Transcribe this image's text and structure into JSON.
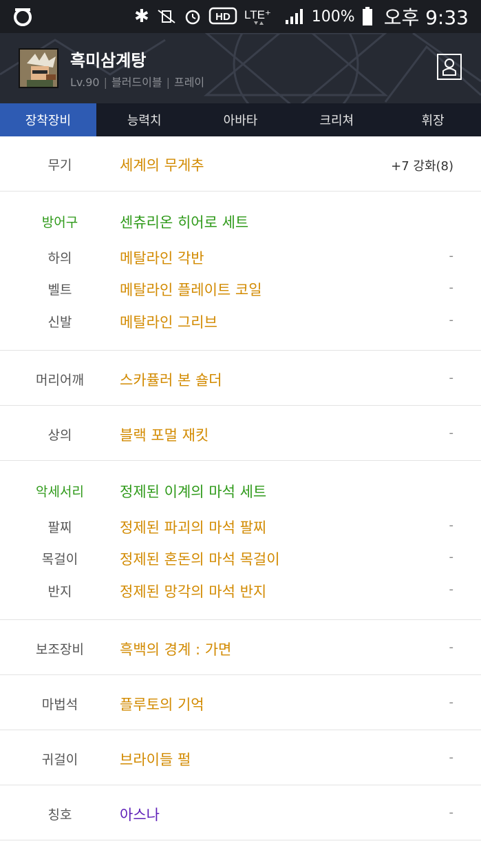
{
  "status_bar": {
    "battery": "100%",
    "time": "오후 9:33",
    "icons": [
      "bluetooth-icon",
      "vibrate-mute-icon",
      "alarm-icon",
      "hd-voice-icon",
      "lte-icon",
      "signal-icon",
      "battery-icon"
    ]
  },
  "profile": {
    "name": "흑미삼계탕",
    "level": "Lv.90",
    "class": "블러드이블",
    "server": "프레이"
  },
  "tabs": [
    {
      "label": "장착장비",
      "active": true
    },
    {
      "label": "능력치",
      "active": false
    },
    {
      "label": "아바타",
      "active": false
    },
    {
      "label": "크리쳐",
      "active": false
    },
    {
      "label": "휘장",
      "active": false
    }
  ],
  "equipment": {
    "weapon": {
      "category": "무기",
      "name": "세계의 무게추",
      "value": "+7 강화(8)"
    },
    "armor": {
      "category": "방어구",
      "set_name": "센츄리온 히어로 세트",
      "items": [
        {
          "category": "하의",
          "name": "메탈라인 각반",
          "value": "-"
        },
        {
          "category": "벨트",
          "name": "메탈라인 플레이트 코일",
          "value": "-"
        },
        {
          "category": "신발",
          "name": "메탈라인 그리브",
          "value": "-"
        }
      ]
    },
    "shoulder": {
      "category": "머리어깨",
      "name": "스카퓰러 본 숄더",
      "value": "-"
    },
    "top": {
      "category": "상의",
      "name": "블랙 포멀 재킷",
      "value": "-"
    },
    "accessory": {
      "category": "악세서리",
      "set_name": "정제된 이계의 마석 세트",
      "items": [
        {
          "category": "팔찌",
          "name": "정제된 파괴의 마석 팔찌",
          "value": "-"
        },
        {
          "category": "목걸이",
          "name": "정제된 혼돈의 마석 목걸이",
          "value": "-"
        },
        {
          "category": "반지",
          "name": "정제된 망각의 마석 반지",
          "value": "-"
        }
      ]
    },
    "sub": {
      "category": "보조장비",
      "name": "흑백의 경계 : 가면",
      "value": "-"
    },
    "magic_stone": {
      "category": "마법석",
      "name": "플루토의 기억",
      "value": "-"
    },
    "earring": {
      "category": "귀걸이",
      "name": "브라이들 펄",
      "value": "-"
    },
    "title": {
      "category": "칭호",
      "name": "아스나",
      "value": "-"
    }
  },
  "colors": {
    "item_gold": "#d28a00",
    "set_green": "#2f9a1a",
    "title_purple": "#5e1fb8",
    "tab_active": "#2e5bb3"
  }
}
